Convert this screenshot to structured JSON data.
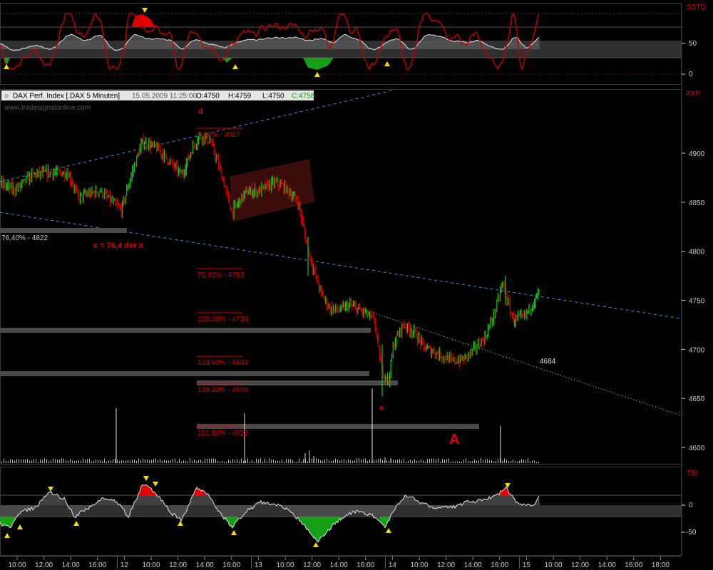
{
  "header": {
    "instrument": "DAX Perf. Index [.DAX  5 Minuten]",
    "datetime": "15.05.2009 11:25:00",
    "open": "O:4750",
    "high": "H:4759",
    "low": "L:4750",
    "close": "C:4758",
    "watermark": "www.tradesignalonline.com"
  },
  "panels": {
    "top_indicator": "SSTO",
    "main_symbol": "XXP",
    "bottom_indicator": "TSI"
  },
  "colors": {
    "background": "#000000",
    "up_bar": "#19c419",
    "down_bar": "#d40000",
    "axis_text": "#d0d0d0",
    "price_labels": "#d40000",
    "trendline": "#4a8fd8",
    "fib_bar": "#4a4a4a",
    "highlight_red": "#e00000",
    "highlight_green": "#17a017",
    "marker_yellow": "#f0e000"
  },
  "x_axis_labels": [
    "10:00",
    "12:00",
    "14:00",
    "16:00",
    "12",
    "10:00",
    "12:00",
    "14:00",
    "16:00",
    "13",
    "10:00",
    "12:00",
    "14:00",
    "16:00",
    "14",
    "10:00",
    "12:00",
    "14:00",
    "16:00",
    "15",
    "10:00",
    "12:00",
    "14:00",
    "16:00",
    "18:00"
  ],
  "annotations": {
    "wave_d": "d",
    "wave_e": "e",
    "wave_A": "A",
    "c_label": "c = 76,4 der a",
    "left_level": "76,40% - 4822",
    "trend_level": "4684"
  },
  "chart_data": [
    {
      "type": "line",
      "title": "SSTO",
      "y_ticks": [
        "50",
        "0"
      ],
      "ylim": [
        -10,
        100
      ]
    },
    {
      "type": "candlestick",
      "title": "DAX Perf. Index [.DAX  5 Minuten]",
      "y_ticks": [
        "4900",
        "4850",
        "4800",
        "4750",
        "4700",
        "4650",
        "4600"
      ],
      "ylim": [
        4580,
        4950
      ],
      "price_path": [
        [
          0,
          4870
        ],
        [
          20,
          4862
        ],
        [
          45,
          4878
        ],
        [
          70,
          4880
        ],
        [
          95,
          4880
        ],
        [
          110,
          4855
        ],
        [
          140,
          4862
        ],
        [
          170,
          4842
        ],
        [
          185,
          4880
        ],
        [
          200,
          4912
        ],
        [
          220,
          4905
        ],
        [
          240,
          4890
        ],
        [
          255,
          4878
        ],
        [
          270,
          4905
        ],
        [
          280,
          4918
        ],
        [
          295,
          4912
        ],
        [
          310,
          4880
        ],
        [
          325,
          4840
        ],
        [
          345,
          4860
        ],
        [
          365,
          4862
        ],
        [
          385,
          4870
        ],
        [
          400,
          4865
        ],
        [
          418,
          4850
        ],
        [
          428,
          4815
        ],
        [
          438,
          4785
        ],
        [
          450,
          4758
        ],
        [
          462,
          4742
        ],
        [
          475,
          4740
        ],
        [
          490,
          4745
        ],
        [
          510,
          4738
        ],
        [
          525,
          4730
        ],
        [
          535,
          4680
        ],
        [
          545,
          4668
        ],
        [
          552,
          4705
        ],
        [
          565,
          4725
        ],
        [
          580,
          4718
        ],
        [
          595,
          4702
        ],
        [
          615,
          4695
        ],
        [
          635,
          4688
        ],
        [
          650,
          4690
        ],
        [
          665,
          4700
        ],
        [
          680,
          4712
        ],
        [
          695,
          4740
        ],
        [
          705,
          4768
        ],
        [
          712,
          4748
        ],
        [
          720,
          4730
        ],
        [
          735,
          4733
        ],
        [
          748,
          4748
        ],
        [
          757,
          4760
        ]
      ],
      "fibonacci_levels": [
        {
          "label": "0,00% - 4927",
          "value": 4927
        },
        {
          "label": "76,40% - 4783",
          "value": 4783
        },
        {
          "label": "100,00% - 4738",
          "value": 4738
        },
        {
          "label": "123,60% - 4694",
          "value": 4694
        },
        {
          "label": "138,20% - 4666",
          "value": 4666
        },
        {
          "label": "161,80% - 4622",
          "value": 4622
        }
      ],
      "support_levels": [
        4822,
        4738,
        4694,
        4666,
        4622
      ],
      "volume_spikes": [
        [
          163,
          4640
        ],
        [
          343,
          4635
        ],
        [
          522,
          4660
        ],
        [
          702,
          4622
        ]
      ]
    },
    {
      "type": "area",
      "title": "TSI",
      "y_ticks": [
        "0",
        "-50"
      ],
      "ylim": [
        -70,
        45
      ]
    }
  ]
}
